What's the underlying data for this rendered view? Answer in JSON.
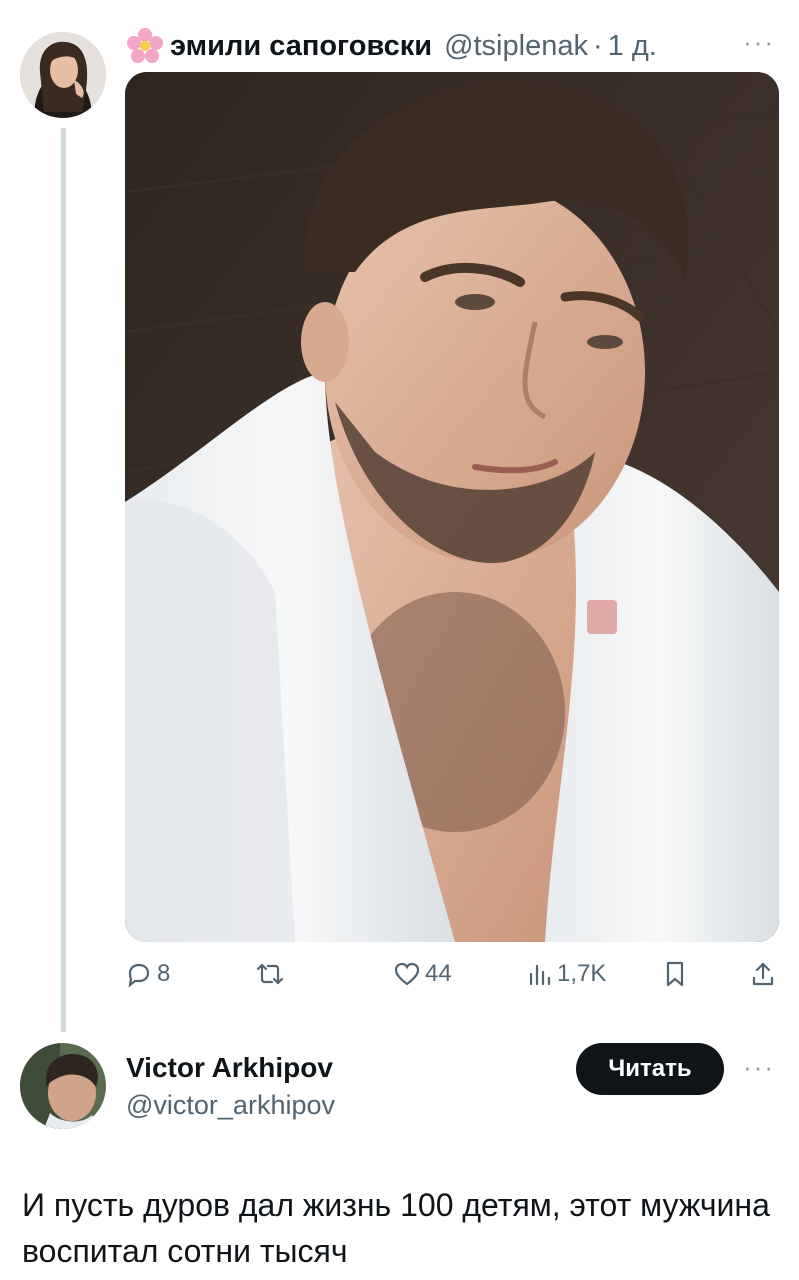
{
  "tweet": {
    "author_emoji": "flower-icon",
    "author_name": "эмили сапоговски",
    "author_handle": "@tsiplenak",
    "separator": "·",
    "time": "1 д.",
    "more": "···",
    "actions": {
      "replies": "8",
      "retweets": "",
      "likes": "44",
      "views": "1,7K"
    }
  },
  "reply": {
    "name": "Victor Arkhipov",
    "handle": "@victor_arkhipov",
    "follow_label": "Читать",
    "more": "···",
    "text": "И пусть дуров дал жизнь 100 детям, этот мужчина воспитал сотни тысяч"
  },
  "colors": {
    "text": "#0f1419",
    "secondary": "#536471",
    "thread_line": "#cfd9de",
    "button_bg": "#0f1419"
  }
}
